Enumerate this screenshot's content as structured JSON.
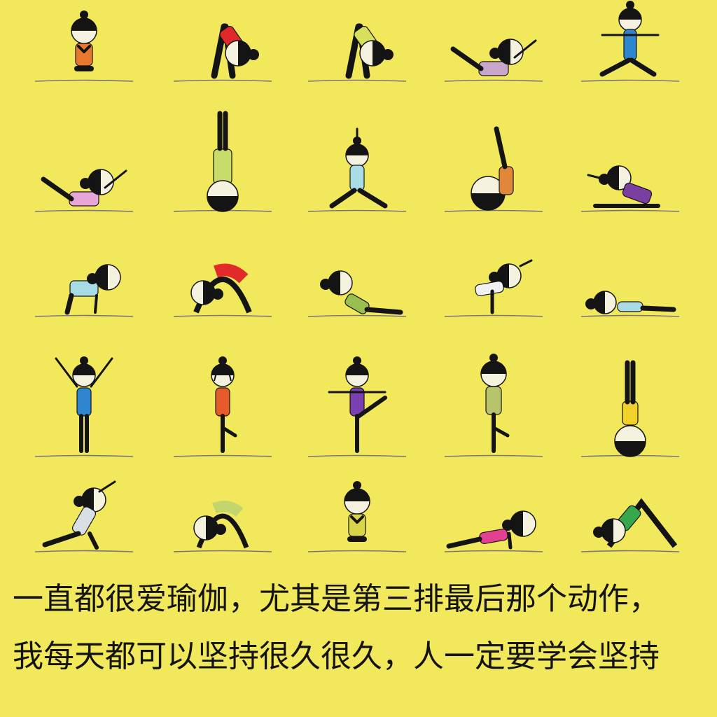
{
  "caption": {
    "line1": "一直都很爱瑜伽，尤其是第三排最后那个动作，",
    "line2": "我每天都可以坚持很久很久，人一定要学会坚持"
  },
  "colors": {
    "background": "#F2E85C",
    "ink": "#141414",
    "face": "#F4F1DF"
  },
  "figures": [
    {
      "pose": "seated-prayer",
      "color": "#E8782E"
    },
    {
      "pose": "standing-forward-fold",
      "color": "#E02A2A"
    },
    {
      "pose": "standing-forward-fold",
      "color": "#D7E05A"
    },
    {
      "pose": "boat",
      "color": "#C7A6C9"
    },
    {
      "pose": "warrior-two",
      "color": "#2F86D0"
    },
    {
      "pose": "boat",
      "color": "#E6A7D8"
    },
    {
      "pose": "shoulder-stand",
      "color": "#C9DC6A"
    },
    {
      "pose": "lunge-arms-up",
      "color": "#A9DCE4"
    },
    {
      "pose": "plough-legs-up",
      "color": "#E0873A"
    },
    {
      "pose": "seated-forward-bend",
      "color": "#7B3FA0"
    },
    {
      "pose": "cat-cow",
      "color": "#A7DCE6"
    },
    {
      "pose": "wheel",
      "color": "#E22A2A"
    },
    {
      "pose": "cobra",
      "color": "#9BBF4E"
    },
    {
      "pose": "crow-balance",
      "color": "#F1F1F1"
    },
    {
      "pose": "prone-lying",
      "color": "#A9DCE4"
    },
    {
      "pose": "standing-arms-up",
      "color": "#2F86D0"
    },
    {
      "pose": "tree",
      "color": "#E55B2A"
    },
    {
      "pose": "standing-balance",
      "color": "#7A3FB0"
    },
    {
      "pose": "tree-prayer",
      "color": "#B7C46B"
    },
    {
      "pose": "headstand",
      "color": "#F2D12A"
    },
    {
      "pose": "crescent-lunge",
      "color": "#D8E0E6"
    },
    {
      "pose": "bridge",
      "color": "#C2D66B"
    },
    {
      "pose": "seated-prayer",
      "color": "#D9D54A"
    },
    {
      "pose": "plank",
      "color": "#E24090"
    },
    {
      "pose": "downward-dog",
      "color": "#36A84B"
    }
  ]
}
